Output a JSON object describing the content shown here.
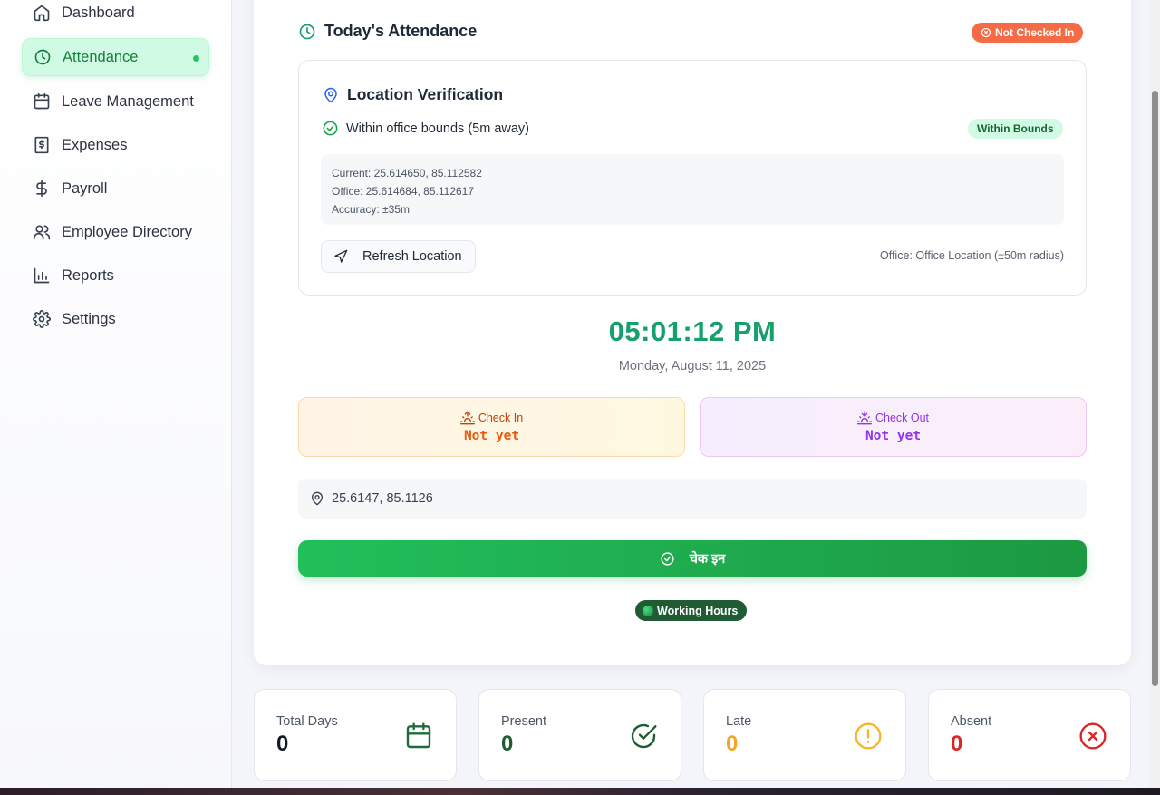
{
  "sidebar": {
    "items": [
      {
        "label": "Dashboard",
        "icon": "home-icon"
      },
      {
        "label": "Attendance",
        "icon": "clock-icon",
        "active": true
      },
      {
        "label": "Leave Management",
        "icon": "calendar-icon"
      },
      {
        "label": "Expenses",
        "icon": "receipt-icon"
      },
      {
        "label": "Payroll",
        "icon": "dollar-icon"
      },
      {
        "label": "Employee Directory",
        "icon": "users-icon"
      },
      {
        "label": "Reports",
        "icon": "bar-chart-icon"
      },
      {
        "label": "Settings",
        "icon": "gear-icon"
      }
    ]
  },
  "attendance": {
    "title": "Today's Attendance",
    "status": "Not Checked In",
    "status_color": "#f46b45"
  },
  "location": {
    "title": "Location Verification",
    "within_text": "Within office bounds (5m away)",
    "badge": "Within Bounds",
    "current": "Current: 25.614650, 85.112582",
    "office": "Office: 25.614684, 85.112617",
    "accuracy": "Accuracy: ±35m",
    "refresh_label": "Refresh Location",
    "office_radius": "Office: Office Location (±50m radius)"
  },
  "clock": {
    "time": "05:01:12 PM",
    "date": "Monday, August 11, 2025"
  },
  "check_in": {
    "label": "Check In",
    "value": "Not yet"
  },
  "check_out": {
    "label": "Check Out",
    "value": "Not yet"
  },
  "gps": {
    "coords": "25.6147, 85.1126"
  },
  "checkin_button": {
    "label": "चेक इन"
  },
  "working_hours": {
    "label": "Working Hours"
  },
  "stats": [
    {
      "label": "Total Days",
      "value": "0",
      "color": "#111827",
      "icon": "calendar-icon",
      "icon_color": "#1f6b3a"
    },
    {
      "label": "Present",
      "value": "0",
      "color": "#1f5b33",
      "icon": "check-circle-icon",
      "icon_color": "#1f5b33"
    },
    {
      "label": "Late",
      "value": "0",
      "color": "#f5a524",
      "icon": "alert-circle-icon",
      "icon_color": "#f5b72a"
    },
    {
      "label": "Absent",
      "value": "0",
      "color": "#dc2626",
      "icon": "x-circle-icon",
      "icon_color": "#dc2626"
    }
  ],
  "colors": {
    "accent_green": "#16a06b",
    "active_nav_bg": "#d1fae5",
    "checkin_button": "#22bf5b"
  }
}
